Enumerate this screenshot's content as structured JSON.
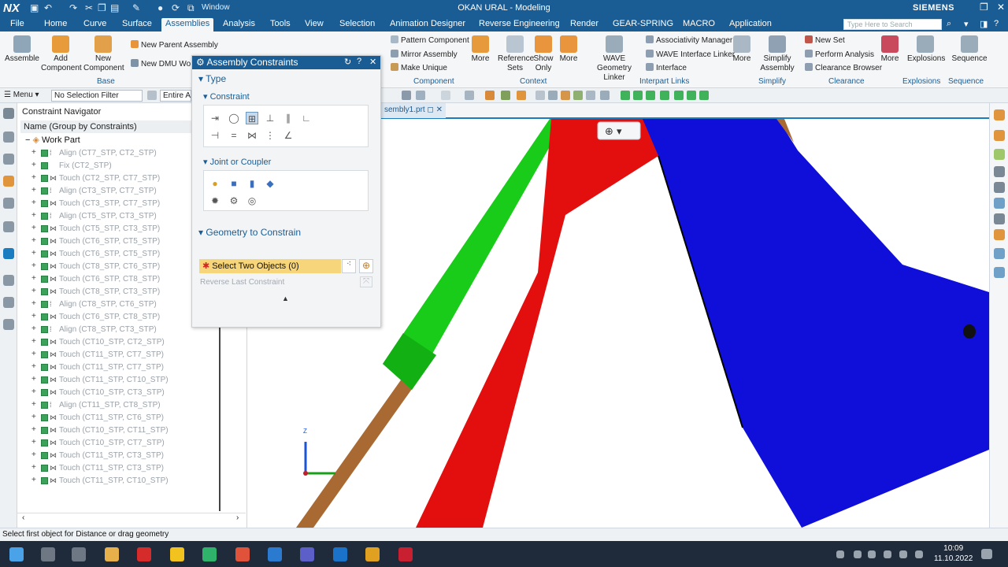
{
  "titlebar": {
    "logo": "NX",
    "window_menu": "Window",
    "title": "OKAN URAL - Modeling",
    "brand": "SIEMENS"
  },
  "menubar": {
    "items": [
      "File",
      "Home",
      "Curve",
      "Surface",
      "Assemblies",
      "Analysis",
      "Tools",
      "View",
      "Selection",
      "Animation Designer",
      "Reverse Engineering",
      "Render",
      "GEAR-SPRING",
      "MACRO",
      "Application"
    ],
    "active": "Assemblies",
    "search_placeholder": "Type Here to Search"
  },
  "ribbon": {
    "assemble": "Assemble",
    "add_component": "Add Component",
    "new_component": "New Component",
    "new_parent_assembly": "New Parent Assembly",
    "new_dmu": "New DMU Wo",
    "base_group": "Base",
    "pattern_component": "Pattern Component",
    "mirror_assembly": "Mirror Assembly",
    "make_unique": "Make Unique",
    "more": "More",
    "component_group": "Component",
    "reference_sets": "Reference Sets",
    "show_only": "Show Only",
    "context_group": "Context",
    "wave_geometry_linker": "WAVE Geometry Linker",
    "associativity_manager": "Associativity Manager",
    "wave_interface_linker": "WAVE Interface Linker",
    "interface": "Interface",
    "interpart_group": "Interpart Links",
    "simplify_assembly": "Simplify Assembly",
    "simplify_group": "Simplify",
    "new_set": "New Set",
    "perform_analysis": "Perform Analysis",
    "clearance_browser": "Clearance Browser",
    "clearance_group": "Clearance",
    "explosions": "Explosions",
    "explosions_group": "Explosions",
    "sequence": "Sequence",
    "sequence_group": "Sequence"
  },
  "filterbar": {
    "menu": "Menu",
    "selection_filter": "No Selection Filter",
    "scope": "Entire As"
  },
  "navigator": {
    "title": "Constraint Navigator",
    "column": "Name (Group by Constraints)",
    "root": "Work Part",
    "rows": [
      {
        "type": "Align",
        "label": "Align (CT7_STP, CT2_STP)"
      },
      {
        "type": "Fix",
        "label": "Fix (CT2_STP)"
      },
      {
        "type": "Touch",
        "label": "Touch (CT2_STP, CT7_STP)"
      },
      {
        "type": "Align",
        "label": "Align (CT3_STP, CT7_STP)"
      },
      {
        "type": "Touch",
        "label": "Touch (CT3_STP, CT7_STP)"
      },
      {
        "type": "Align",
        "label": "Align (CT5_STP, CT3_STP)"
      },
      {
        "type": "Touch",
        "label": "Touch (CT5_STP, CT3_STP)"
      },
      {
        "type": "Touch",
        "label": "Touch (CT6_STP, CT5_STP)"
      },
      {
        "type": "Touch",
        "label": "Touch (CT6_STP, CT5_STP)"
      },
      {
        "type": "Touch",
        "label": "Touch (CT8_STP, CT6_STP)"
      },
      {
        "type": "Touch",
        "label": "Touch (CT6_STP, CT8_STP)"
      },
      {
        "type": "Touch",
        "label": "Touch (CT8_STP, CT3_STP)"
      },
      {
        "type": "Align",
        "label": "Align (CT8_STP, CT6_STP)"
      },
      {
        "type": "Touch",
        "label": "Touch (CT6_STP, CT8_STP)"
      },
      {
        "type": "Align",
        "label": "Align (CT8_STP, CT3_STP)"
      },
      {
        "type": "Touch",
        "label": "Touch (CT10_STP, CT2_STP)"
      },
      {
        "type": "Touch",
        "label": "Touch (CT11_STP, CT7_STP)"
      },
      {
        "type": "Touch",
        "label": "Touch (CT11_STP, CT7_STP)"
      },
      {
        "type": "Touch",
        "label": "Touch (CT11_STP, CT10_STP)"
      },
      {
        "type": "Touch",
        "label": "Touch (CT10_STP, CT3_STP)"
      },
      {
        "type": "Align",
        "label": "Align (CT11_STP, CT8_STP)"
      },
      {
        "type": "Touch",
        "label": "Touch (CT11_STP, CT6_STP)"
      },
      {
        "type": "Touch",
        "label": "Touch (CT10_STP, CT11_STP)"
      },
      {
        "type": "Touch",
        "label": "Touch (CT10_STP, CT7_STP)"
      },
      {
        "type": "Touch",
        "label": "Touch (CT11_STP, CT3_STP)"
      },
      {
        "type": "Touch",
        "label": "Touch (CT11_STP, CT3_STP)"
      },
      {
        "type": "Touch",
        "label": "Touch (CT11_STP, CT10_STP)"
      }
    ]
  },
  "dialog": {
    "title": "Assembly Constraints",
    "type_section": "Type",
    "constraint_subsection": "Constraint",
    "joint_subsection": "Joint or Coupler",
    "geometry_section": "Geometry to Constrain",
    "select_label": "Select Two Objects (0)",
    "reverse_label": "Reverse Last Constraint"
  },
  "tab": {
    "label": "sembly1.prt"
  },
  "statusbar": {
    "text": "Select first object for Distance or drag geometry"
  },
  "taskbar": {
    "time": "10:09",
    "date": "11.10.2022"
  },
  "colors": {
    "accent": "#1a5d94",
    "green_part": "#19cc19",
    "red_part": "#e30e0e",
    "blue_part": "#0f0fd9",
    "rod": "#a86a32",
    "selection_highlight": "#f7d57a"
  }
}
